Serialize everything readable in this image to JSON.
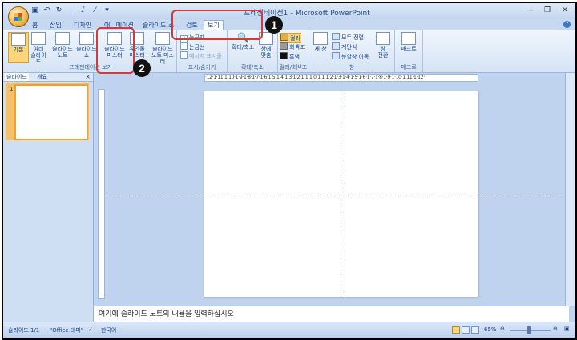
{
  "window": {
    "title": "프레젠테이션1 - Microsoft PowerPoint",
    "qat_icons": [
      "save-icon",
      "undo-icon",
      "redo-icon",
      "separator",
      "italic-icon",
      "format-icon",
      "dropdown-icon"
    ]
  },
  "tabs": [
    {
      "label": "홈"
    },
    {
      "label": "삽입"
    },
    {
      "label": "디자인"
    },
    {
      "label": "애니메이션"
    },
    {
      "label": "슬라이드 쇼"
    },
    {
      "label": "검토"
    },
    {
      "label": "보기",
      "active": true
    }
  ],
  "ribbon": {
    "views_group": {
      "label": "프레젠테이션 보기",
      "buttons": [
        {
          "label": "기본",
          "selected": true
        },
        {
          "label": "여러\n슬라이드"
        },
        {
          "label": "슬라이드\n노트"
        },
        {
          "label": "슬라이드\n쇼"
        },
        {
          "label": "슬라이드\n마스터"
        },
        {
          "label": "유인물\n마스터"
        },
        {
          "label": "슬라이드\n노트 마스터"
        }
      ]
    },
    "show_group": {
      "label": "표시/숨기기",
      "items": [
        {
          "label": "눈금자",
          "checked": true
        },
        {
          "label": "눈금선",
          "checked": false
        },
        {
          "label": "메시지 표시줄",
          "checked": false,
          "disabled": true
        }
      ]
    },
    "zoom_group": {
      "label": "확대/축소",
      "buttons": [
        {
          "label": "확대/축소"
        },
        {
          "label": "창에\n맞춤"
        }
      ]
    },
    "color_group": {
      "label": "컬러/회색조",
      "items": [
        {
          "label": "컬러",
          "selected": true
        },
        {
          "label": "회색조"
        },
        {
          "label": "흑백"
        }
      ]
    },
    "window_group": {
      "label": "창",
      "new_window": "새 창",
      "items": [
        {
          "label": "모두 정렬"
        },
        {
          "label": "계단식"
        },
        {
          "label": "분할창 이동"
        }
      ],
      "switch_window": "창\n전환"
    },
    "macro_group": {
      "label": "매크로",
      "button": "매크로"
    }
  },
  "annotations": [
    {
      "number": "1"
    },
    {
      "number": "2"
    }
  ],
  "left_panel": {
    "tabs": [
      {
        "label": "슬라이드",
        "active": true
      },
      {
        "label": "개요"
      }
    ],
    "close": "×",
    "slide_number": "1"
  },
  "ruler": {
    "text": "·12·1·11·1·10·1·9·1·8·1·7·1·6·1·5·1·4·1·3·1·2·1·1·1·0·1·1·1·2·1·3·1·4·1·5·1·6·1·7·1·8·1·9·1·10·1·11·1·12·"
  },
  "notes": {
    "placeholder": "여기에 슬라이드 노트의 내용을 입력하십시오"
  },
  "status": {
    "slide": "슬라이드 1/1",
    "theme": "\"Office 테마\"",
    "language": "한국어",
    "zoom": "65%"
  }
}
